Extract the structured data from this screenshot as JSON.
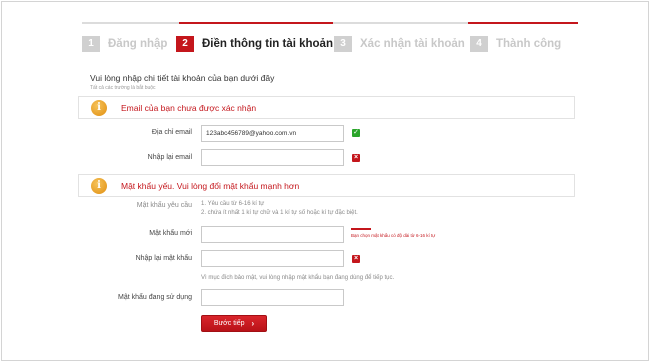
{
  "steps": [
    {
      "num": "1",
      "label": "Đăng nhập",
      "active": false
    },
    {
      "num": "2",
      "label": "Điền thông tin tài khoản",
      "active": true
    },
    {
      "num": "3",
      "label": "Xác nhận tài khoản",
      "active": false
    },
    {
      "num": "4",
      "label": "Thành công",
      "active": false
    }
  ],
  "intro": {
    "title": "Vui lòng nhập chi tiết tài khoản của bạn dưới đây",
    "subtitle": "Tất cả các trường là bắt buộc"
  },
  "email_notice": {
    "icon": "info-icon",
    "text": "Email của bạn chưa được xác nhận"
  },
  "email": {
    "label": "Địa chỉ email",
    "value": "123abc456789@yahoo.com.vn",
    "confirm_label": "Nhập lại email",
    "confirm_value": ""
  },
  "password_notice": {
    "icon": "info-icon",
    "text": "Mật khẩu yếu. Vui lòng đổi mật khẩu mạnh hơn"
  },
  "password": {
    "requirements_label": "Mật khẩu yêu cầu",
    "requirement_1": "1. Yêu cầu từ 6-16 kí tự",
    "requirement_2": "2. chứa ít nhất 1 kí tự chữ và 1 kí tự số hoặc kí tự đặc biệt.",
    "new_label": "Mật khẩu mới",
    "new_value": "",
    "new_hint": "Bạn chọn mật khẩu có độ dài từ 6-16 kí tự",
    "confirm_label": "Nhập lại mật khẩu",
    "confirm_value": "",
    "security_note": "Vì mục đích bảo mật, vui lòng nhập mật khẩu bạn đang dùng để tiếp tục.",
    "current_label": "Mật khẩu đang sử dụng",
    "current_value": ""
  },
  "submit": {
    "label": "Bước tiếp",
    "icon": "chevron-right-icon"
  },
  "colors": {
    "accent": "#c4161c",
    "ok": "#2aa52a",
    "inactive": "#c8c8c8"
  }
}
